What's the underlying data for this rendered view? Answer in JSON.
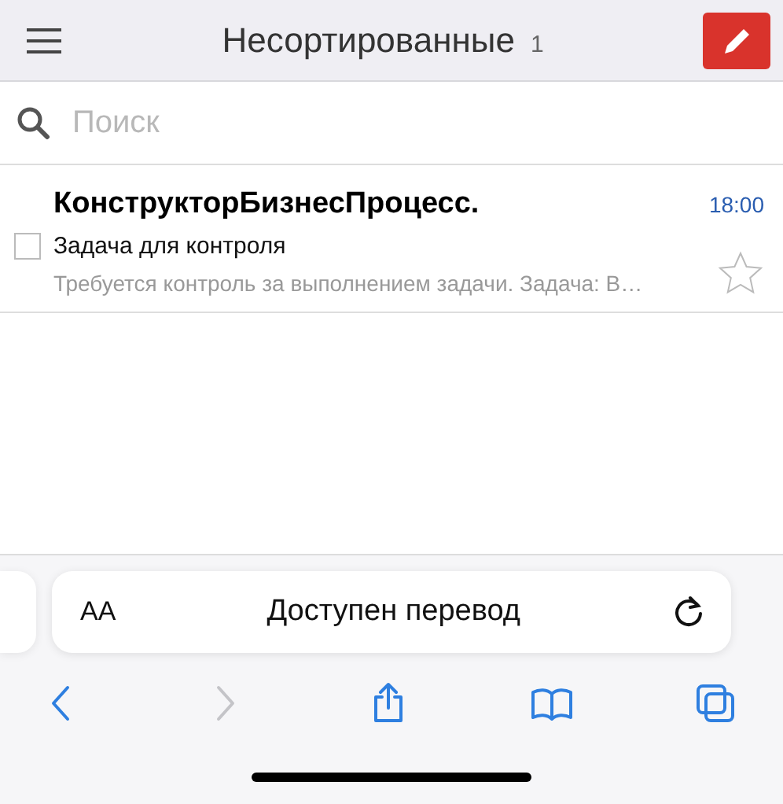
{
  "header": {
    "title": "Несортированные",
    "count": "1"
  },
  "search": {
    "placeholder": "Поиск"
  },
  "messages": [
    {
      "sender": "КонструкторБизнесПроцесс.",
      "time": "18:00",
      "subject": "Задача для контроля",
      "preview": "Требуется контроль за выполнением задачи. Задача: В…",
      "checked": false,
      "starred": false
    }
  ],
  "browser_bar": {
    "text_size": "AA",
    "notice": "Доступен перевод"
  },
  "toolbar": [
    {
      "kind": "back",
      "disabled": false
    },
    {
      "kind": "forward",
      "disabled": true
    },
    {
      "kind": "share",
      "disabled": false
    },
    {
      "kind": "bookmarks",
      "disabled": false
    },
    {
      "kind": "tabs",
      "disabled": false
    }
  ]
}
